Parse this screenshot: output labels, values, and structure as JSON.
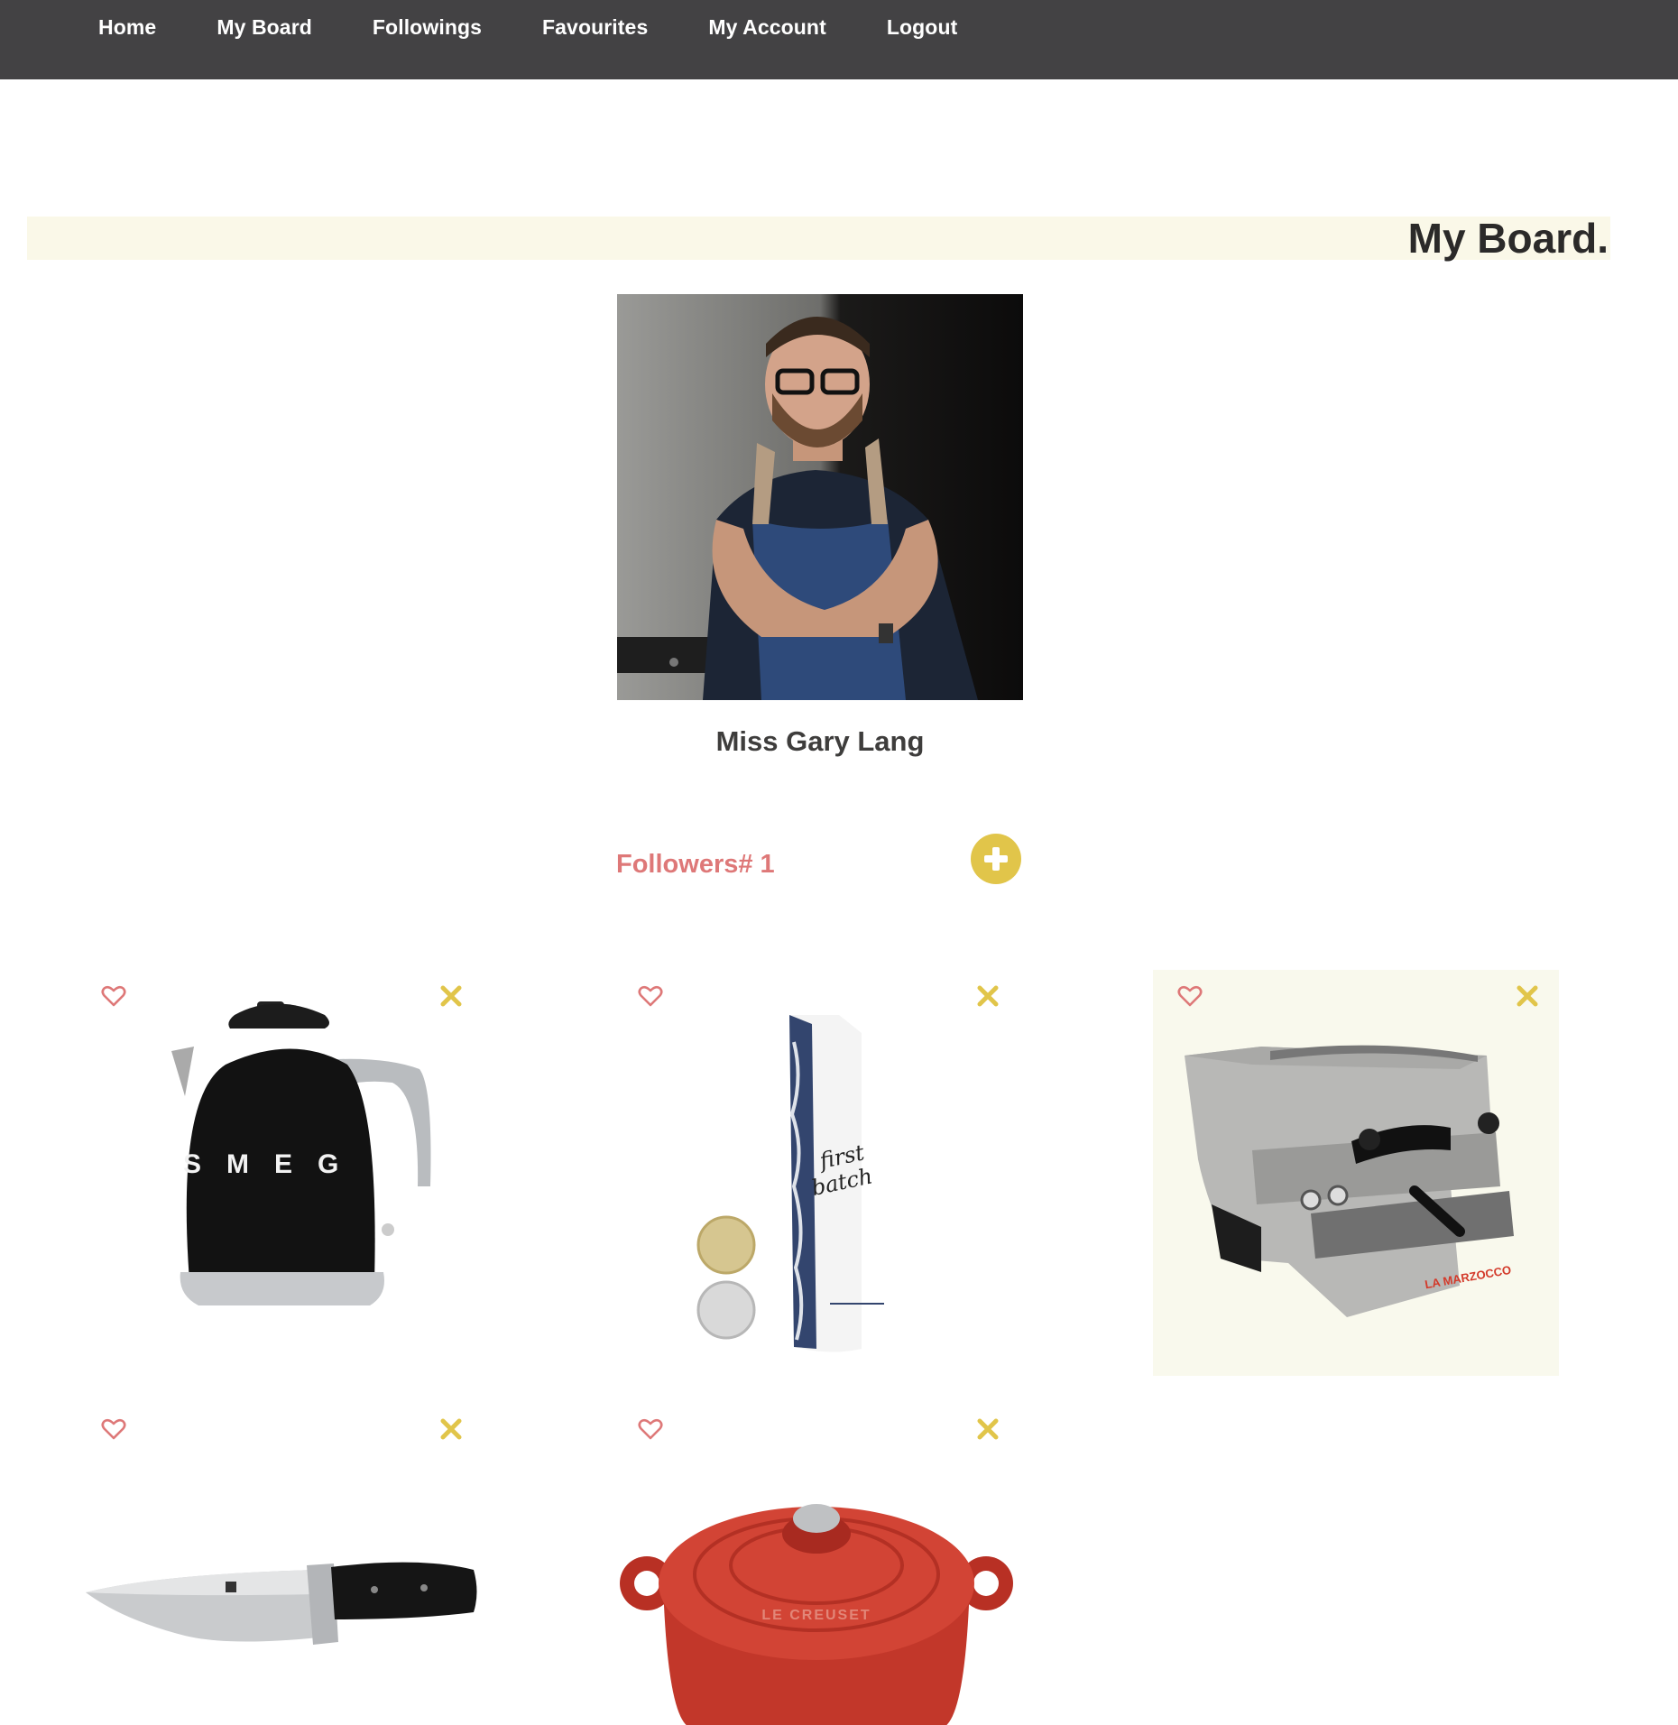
{
  "nav": {
    "items": [
      {
        "label": "Home"
      },
      {
        "label": "My Board"
      },
      {
        "label": "Followings"
      },
      {
        "label": "Favourites"
      },
      {
        "label": "My Account"
      },
      {
        "label": "Logout"
      }
    ]
  },
  "page": {
    "title": "My Board."
  },
  "profile": {
    "name": "Miss Gary Lang",
    "followers_label": "Followers# 1"
  },
  "products": [
    {
      "name": "smeg-kettle",
      "brand_text": "S M E G"
    },
    {
      "name": "coffee-bag",
      "brand_text": "first batch"
    },
    {
      "name": "espresso-machine",
      "brand_text": "LA MARZOCCO"
    },
    {
      "name": "chef-knife",
      "brand_text": ""
    },
    {
      "name": "cast-iron-pot",
      "brand_text": "LE CREUSET"
    }
  ],
  "colors": {
    "nav_bg": "#434244",
    "title_bar_bg": "#faf8e8",
    "accent_red": "#de7878",
    "accent_yellow": "#e1c54a"
  },
  "icons": {
    "favourite": "heart-outline-icon",
    "remove": "close-x-icon",
    "follow": "plus-circle-icon"
  }
}
